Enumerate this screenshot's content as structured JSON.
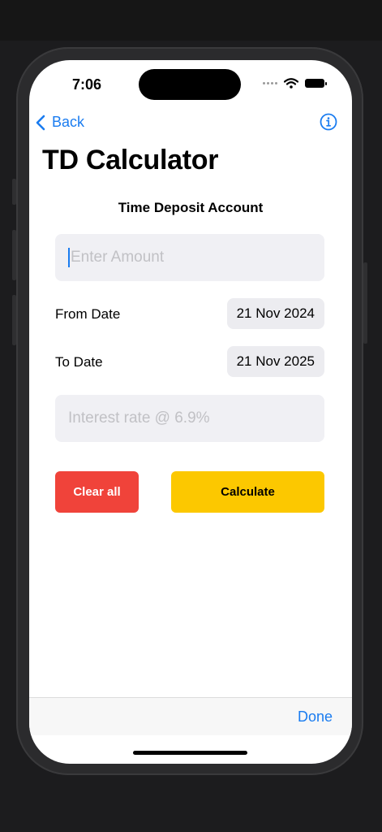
{
  "status_bar": {
    "time": "7:06"
  },
  "nav": {
    "back_label": "Back"
  },
  "page": {
    "title": "TD Calculator",
    "subtitle": "Time Deposit Account"
  },
  "form": {
    "amount_placeholder": "Enter Amount",
    "from_date_label": "From Date",
    "from_date_value": "21 Nov 2024",
    "to_date_label": "To Date",
    "to_date_value": "21 Nov 2025",
    "interest_placeholder": "Interest rate @ 6.9%"
  },
  "actions": {
    "clear_label": "Clear all",
    "calculate_label": "Calculate"
  },
  "keyboard_toolbar": {
    "done_label": "Done"
  },
  "colors": {
    "accent": "#1a7cf0",
    "clear_button": "#f0433a",
    "calculate_button": "#fcc800"
  }
}
